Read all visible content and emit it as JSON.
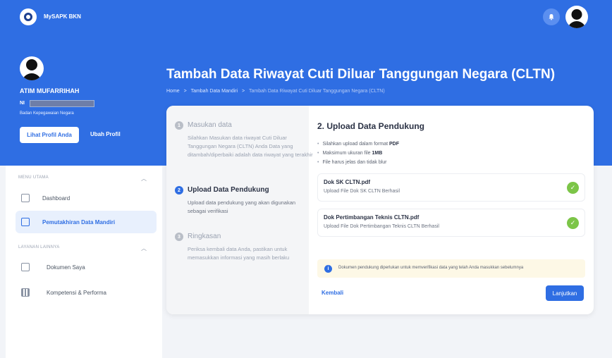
{
  "app": {
    "name": "MySAPK BKN"
  },
  "profile": {
    "name": "ATIM MUFARRIHAH",
    "nip_label": "NI",
    "organization": "Badan Kepegawaian Negara",
    "view_profile_label": "Lihat Profil Anda",
    "edit_profile_label": "Ubah Profil"
  },
  "sidebar": {
    "sections": [
      {
        "label": "MENU UTAMA",
        "items": [
          {
            "label": "Dashboard",
            "icon": "dashboard-icon",
            "active": false
          },
          {
            "label": "Pemutakhiran Data Mandiri",
            "icon": "data-update-icon",
            "active": true
          }
        ]
      },
      {
        "label": "LAYANAN LAINNYA",
        "items": [
          {
            "label": "Dokumen Saya",
            "icon": "document-icon",
            "active": false
          },
          {
            "label": "Kompetensi & Performa",
            "icon": "competency-icon",
            "active": false
          }
        ]
      }
    ]
  },
  "page": {
    "title": "Tambah Data Riwayat Cuti Diluar Tanggungan Negara (CLTN)",
    "breadcrumb": [
      "Home",
      "Tambah Data Mandiri",
      "Tambah Data Riwayat Cuti Diluar Tanggungan Negara (CLTN)"
    ],
    "breadcrumb_separator": ">"
  },
  "steps": [
    {
      "number": "1",
      "title": "Masukan data",
      "description": "Silahkan Masukan data riwayat Cuti Diluar Tanggungan Negara (CLTN) Anda Data yang ditambah/diperbaiki adalah data riwayat yang terakhir",
      "active": false
    },
    {
      "number": "2",
      "title": "Upload Data Pendukung",
      "description": "Upload data pendukung yang akan digunakan sebagai verifikasi",
      "active": true
    },
    {
      "number": "3",
      "title": "Ringkasan",
      "description": "Periksa kembali data Anda, pastikan untuk memasukkan informasi yang masih berlaku",
      "active": false
    }
  ],
  "upload": {
    "title": "2. Upload Data Pendukung",
    "requirements": [
      {
        "text": "Silahkan upload dalam format ",
        "bold": "PDF"
      },
      {
        "text": "Maksimum ukuran file ",
        "bold": "1MB"
      },
      {
        "text": "File harus jelas dan tidak blur",
        "bold": ""
      }
    ],
    "files": [
      {
        "name": "Dok SK CLTN.pdf",
        "status": "Upload File Dok SK CLTN Berhasil"
      },
      {
        "name": "Dok Pertimbangan Teknis CLTN.pdf",
        "status": "Upload File Dok Pertimbangan Teknis CLTN Berhasil"
      }
    ],
    "notice": "Dokumen pendukung diperlukan untuk memverifikasi data yang telah Anda masukkan sebelumnya",
    "back_label": "Kembali",
    "next_label": "Lanjutkan"
  },
  "colors": {
    "primary": "#2f6ee3",
    "success": "#7cc548",
    "notice_bg": "#fdf8e6"
  }
}
